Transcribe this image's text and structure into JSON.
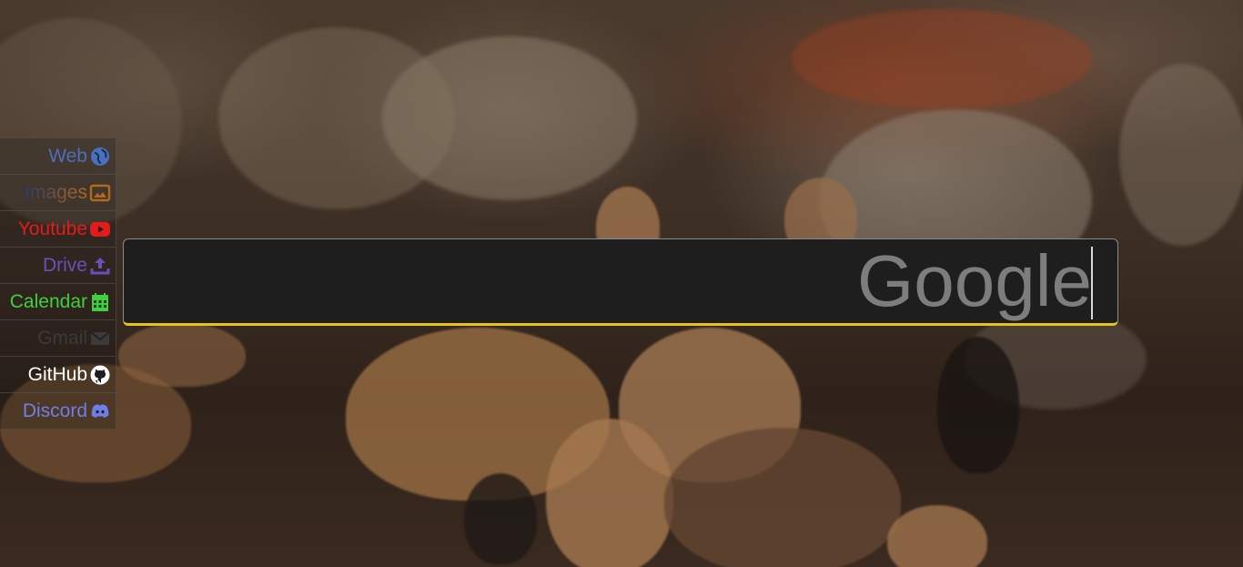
{
  "sidebar": {
    "items": [
      {
        "label": "Web",
        "icon": "globe-icon",
        "color": "#4a6fbd"
      },
      {
        "label": "Images",
        "icon": "image-icon",
        "color": "#b06a1a"
      },
      {
        "label": "Youtube",
        "icon": "youtube-icon",
        "color": "#e31b1b"
      },
      {
        "label": "Drive",
        "icon": "upload-icon",
        "color": "#6a4fbd"
      },
      {
        "label": "Calendar",
        "icon": "calendar-icon",
        "color": "#3fcf3f"
      },
      {
        "label": "Gmail",
        "icon": "envelope-icon",
        "color": "#3a3a3a"
      },
      {
        "label": "GitHub",
        "icon": "github-icon",
        "color": "#ffffff"
      },
      {
        "label": "Discord",
        "icon": "discord-icon",
        "color": "#6f7ee8"
      }
    ]
  },
  "search": {
    "placeholder": "Google",
    "accent": "#e8c21a",
    "background": "#1e1e1e"
  }
}
